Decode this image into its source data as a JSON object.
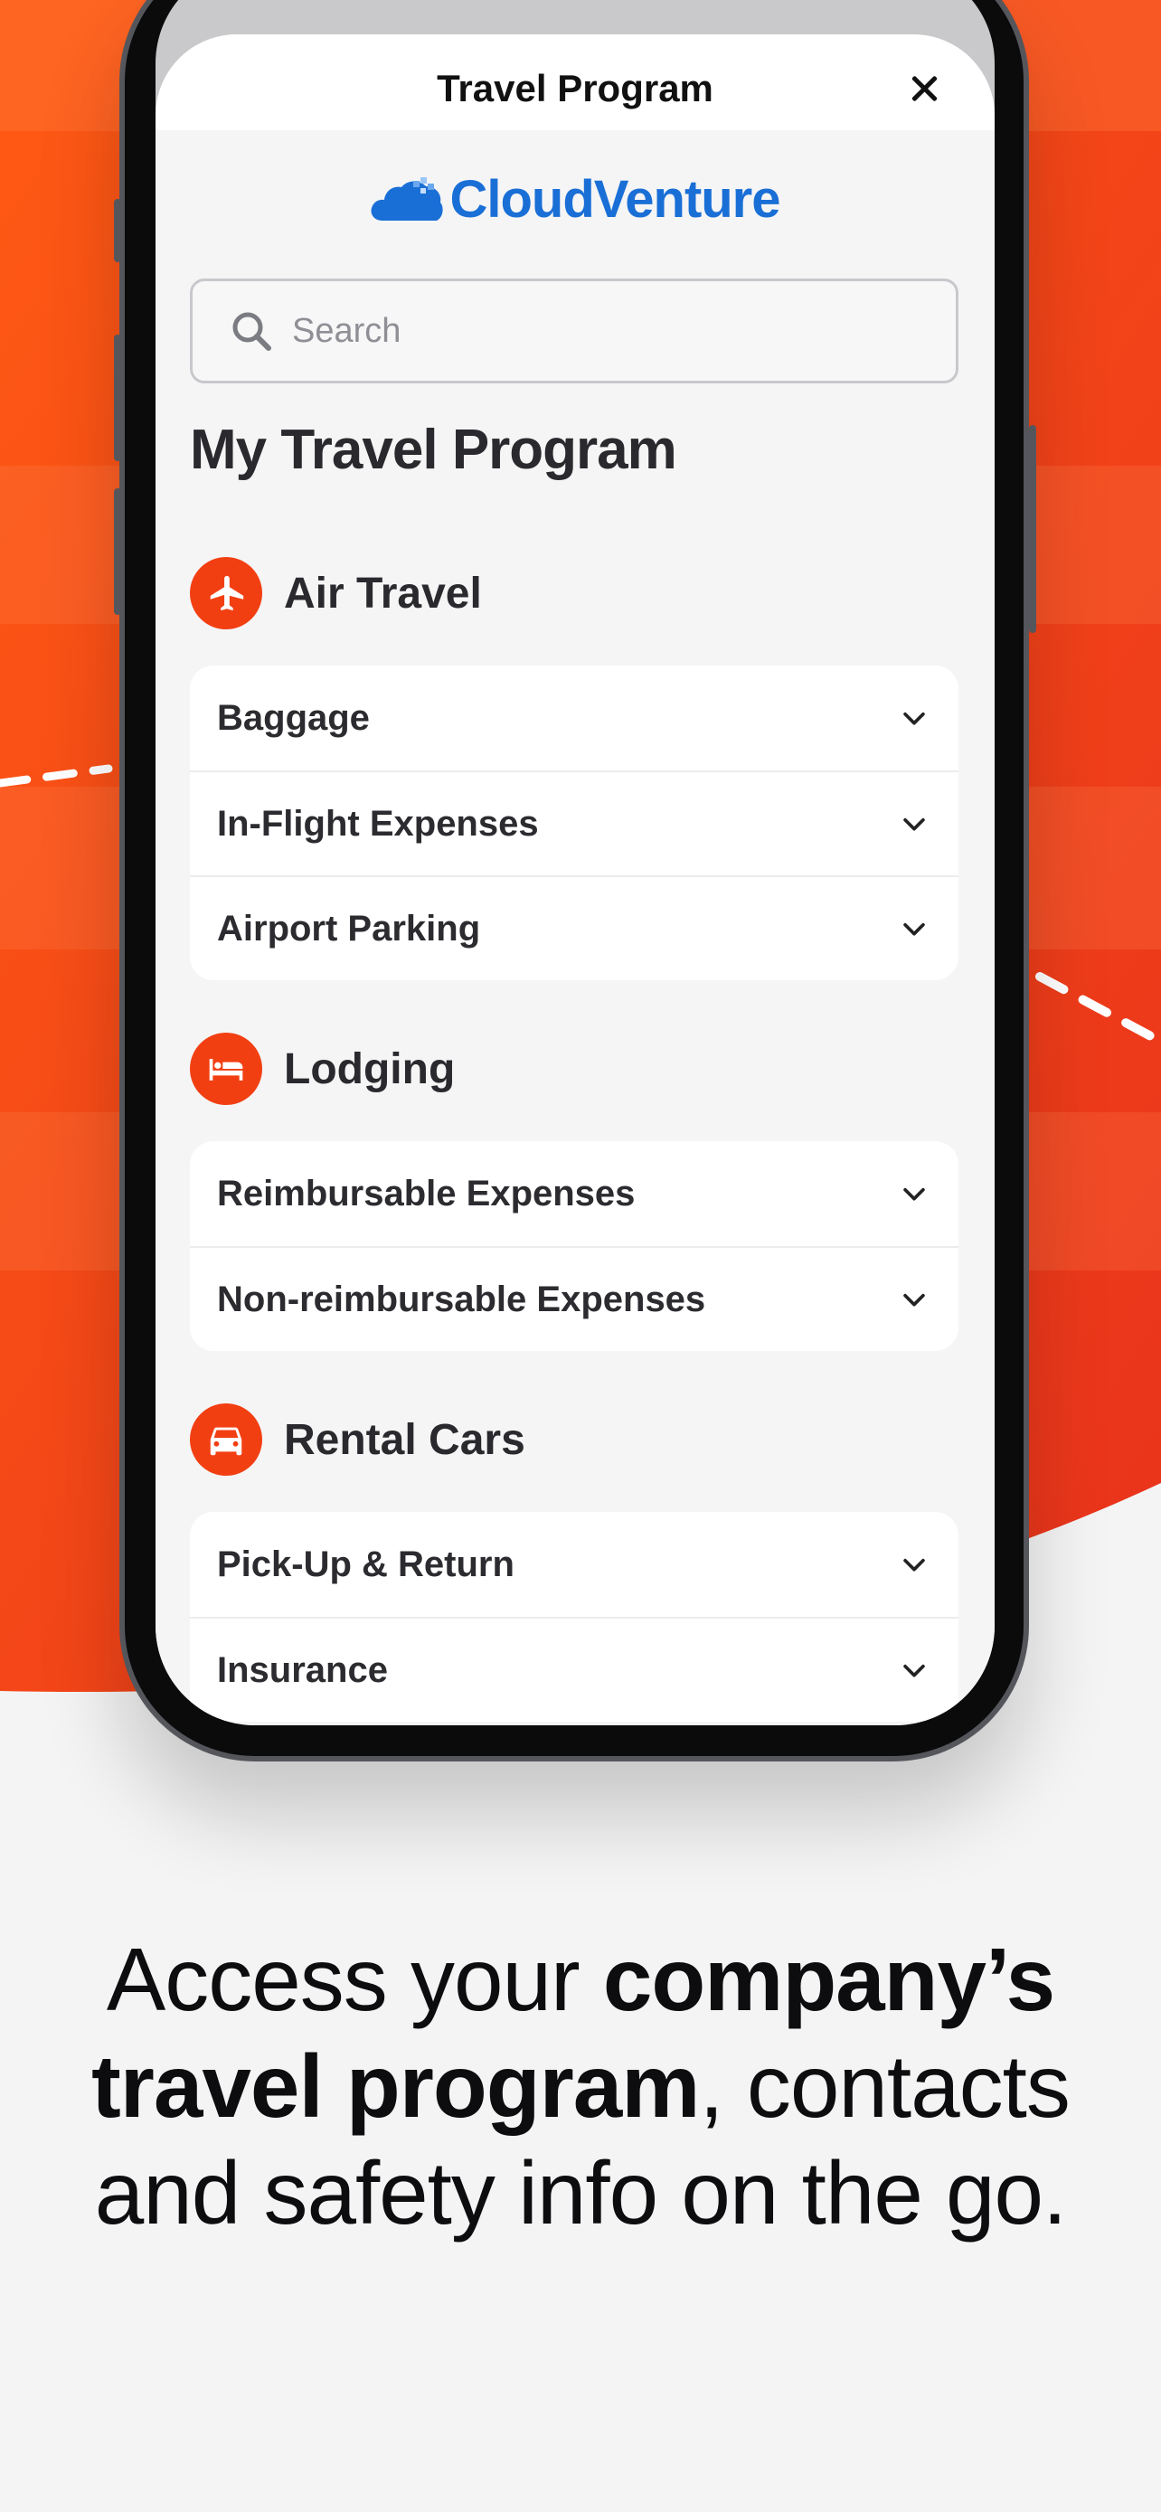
{
  "colors": {
    "accent": "#f23f12",
    "brand_blue": "#1a6fd6",
    "background_orange": "#f04a14"
  },
  "sheet": {
    "title": "Travel Program",
    "close_icon": "close-icon"
  },
  "logo": {
    "text": "CloudVenture",
    "icon": "cloud-icon"
  },
  "search": {
    "placeholder": "Search",
    "value": "",
    "icon": "search-icon"
  },
  "program_title": "My Travel Program",
  "categories": [
    {
      "label": "Air Travel",
      "icon": "airplane-icon",
      "items": [
        "Baggage",
        "In-Flight Expenses",
        "Airport Parking"
      ]
    },
    {
      "label": "Lodging",
      "icon": "bed-icon",
      "items": [
        "Reimbursable Expenses",
        "Non-reimbursable Expenses"
      ]
    },
    {
      "label": "Rental Cars",
      "icon": "car-icon",
      "items": [
        "Pick-Up & Return",
        "Insurance"
      ]
    }
  ],
  "tagline": {
    "part1": "Access your ",
    "bold1": "company’s travel program",
    "part2": ", contacts and safety info on the go."
  }
}
